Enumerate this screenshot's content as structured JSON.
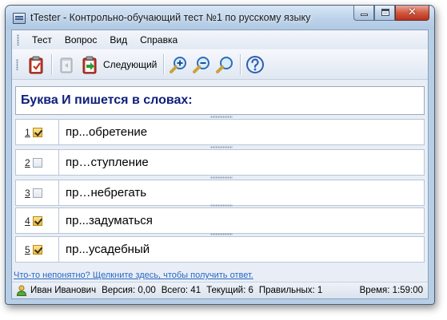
{
  "window": {
    "title": "tTester - Контрольно-обучающий тест №1 по русскому языку",
    "caption": {
      "close_glyph": "✕"
    }
  },
  "menu": [
    "Тест",
    "Вопрос",
    "Вид",
    "Справка"
  ],
  "toolbar": {
    "next_label": "Следующий",
    "icons": [
      "test-check-icon",
      "prev-question-icon",
      "next-question-icon",
      "zoom-in-icon",
      "zoom-out-icon",
      "zoom-reset-icon",
      "help-icon"
    ]
  },
  "question": {
    "text": "Буква И пишется в словах:"
  },
  "answers": [
    {
      "num": "1",
      "checked": true,
      "word": "пр...обретение"
    },
    {
      "num": "2",
      "checked": false,
      "word": "пр…ступление"
    },
    {
      "num": "3",
      "checked": false,
      "word": "пр…небрегать"
    },
    {
      "num": "4",
      "checked": true,
      "word": "пр...задуматься"
    },
    {
      "num": "5",
      "checked": true,
      "word": "пр...усадебный"
    }
  ],
  "hint": "Что-то непонятно? Щелкните здесь, чтобы получить ответ.",
  "status": {
    "user": "Иван Иванович",
    "version": "Версия: 0,00",
    "total": "Всего: 41",
    "current": "Текущий: 6",
    "correct": "Правильных: 1",
    "time": "Время: 1:59:00"
  },
  "colors": {
    "question_text": "#0d1e7a",
    "hint_link": "#2868c3",
    "checkbox_checked": "#f1b93a"
  }
}
